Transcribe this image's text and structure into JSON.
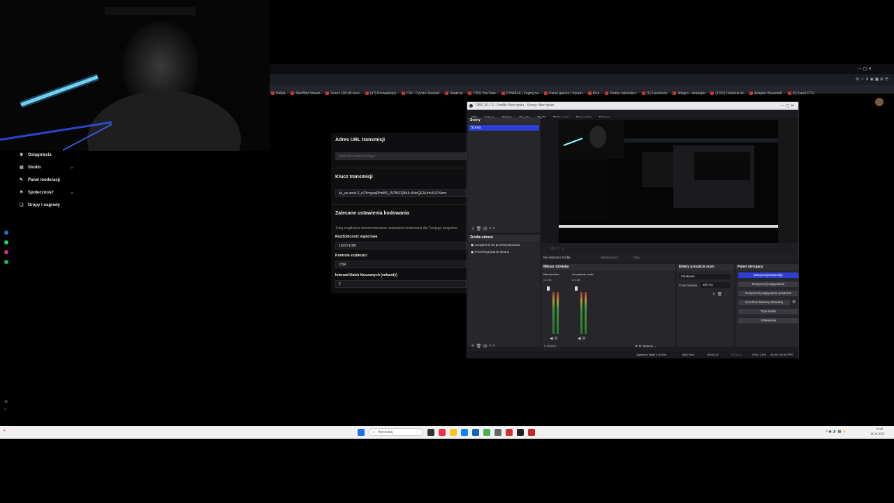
{
  "sidebar": {
    "items": [
      {
        "label": "Osiągnięcia",
        "icon": "trophy-icon"
      },
      {
        "label": "Studio",
        "icon": "studio-icon"
      },
      {
        "label": "Panel moderacji",
        "icon": "wrench-icon"
      },
      {
        "label": "Społeczność",
        "icon": "community-icon"
      },
      {
        "label": "Dropy i nagrody",
        "icon": "gift-icon"
      }
    ]
  },
  "bookmarks": [
    "Rabat",
    "SkinBlitz Steam",
    "Gracz 100,00 euro",
    "(97) Prowadzący",
    "CSI - Czysto Stosowi",
    "Skate pl",
    "(750) YouTube",
    "RYWALE | Zagraj na",
    "Panel gracza | Steam",
    "Kick",
    "Rodny calendarz",
    "(1) Facebook",
    "Allegro - strategie",
    "(1102) Ostatnie kli",
    "Adapter Bluetooth",
    "(6) Karol FTS!"
  ],
  "settings": {
    "url_title": "Adres URL transmisji",
    "url_value": "rtmp://live.twitch.tv/app/",
    "key_title": "Klucz transmisji",
    "key_value": "sk_us-west-2_n2YmgaqRHeBS_W7fNZQB4ILr6obQEAUrtoXUPXwm",
    "enc_title": "Zalecane ustawienia kodowania",
    "enc_desc": "Tutaj znajdziesz rekomendowane ustawienia kodowania dla Twojego programu",
    "res_label": "Rozdzielczość wyjściowa",
    "res_value": "1920×1080",
    "rate_label": "Kontrola szybkości",
    "rate_value": "CBR",
    "key_int_label": "Interwał klatek kluczowych (sekundy)",
    "key_int_value": "2"
  },
  "obs": {
    "title": "OBS 30.1.2 - Profile: Bez tytułu - Sceny: Bez tytułu",
    "menu": [
      "Plik",
      "Edycja",
      "Widok",
      "Panele",
      "Profil",
      "Zbiór scen",
      "Narzędzia",
      "Pomoc"
    ],
    "scenes_title": "Sceny",
    "scene_item": "Scena",
    "sources_title": "Źródła obrazu",
    "sources": [
      "Urządzenie do przechwytywania",
      "Przechwytywanie ekranu"
    ],
    "no_source": "Nie wybrano źródła",
    "properties": "Właściwości",
    "filters": "Filtry",
    "mixer_title": "Mikser dźwięku",
    "mixer_tracks": [
      "Mikrofon/Aux",
      "Urządzenie audio"
    ],
    "mixer_db": "0.0 dB",
    "hidden": "0 hidden",
    "options": "Options",
    "transitions_title": "Efekty przejścia scen",
    "transition_value": "Zanikanie",
    "duration_label": "Czas trwania",
    "duration_value": "300 ms",
    "controls_title": "Panel sterujący",
    "controls": [
      "Zatrzymaj transmisję",
      "Rozpocznij nagrywanie",
      "Rozpocznij nagrywanie powtórek",
      "Uruchom kamerę wirtualną",
      "Tryb studia",
      "Ustawienia"
    ],
    "status": [
      "Zgubione klatki 0 (0.0%)",
      "6867 kb/s",
      "00:00:12",
      "00:00:00",
      "CPU: 2.8%",
      "30.00 / 30.00 FPS"
    ]
  },
  "taskbar": {
    "search_placeholder": "Wyszukaj",
    "time": "19:26",
    "date": "14.04.2024"
  }
}
